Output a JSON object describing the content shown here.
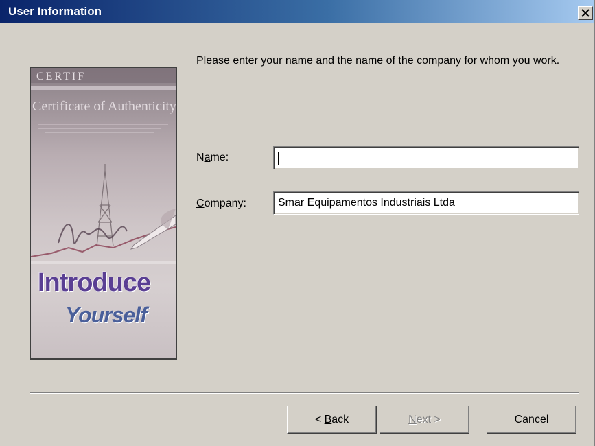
{
  "window": {
    "title": "User Information",
    "close_glyph": "✕"
  },
  "side_image": {
    "line1": "Introduce",
    "line2": "Yourself",
    "certificate_text": "Certificate of Authenticity"
  },
  "instructions": "Please enter your name and the name of the company for whom you work.",
  "form": {
    "name_label_pre": "N",
    "name_label_ul": "a",
    "name_label_post": "me:",
    "name_value": "",
    "company_label_pre": "",
    "company_label_ul": "C",
    "company_label_post": "ompany:",
    "company_value": "Smar Equipamentos Industriais Ltda"
  },
  "buttons": {
    "back_prefix": "< ",
    "back_ul": "B",
    "back_rest": "ack",
    "next_ul": "N",
    "next_rest": "ext >",
    "cancel": "Cancel"
  },
  "colors": {
    "titlebar_start": "#0a246a",
    "titlebar_end": "#a6caf0",
    "dialog_bg": "#d4d0c8",
    "intro_purple": "#5a3f93"
  }
}
